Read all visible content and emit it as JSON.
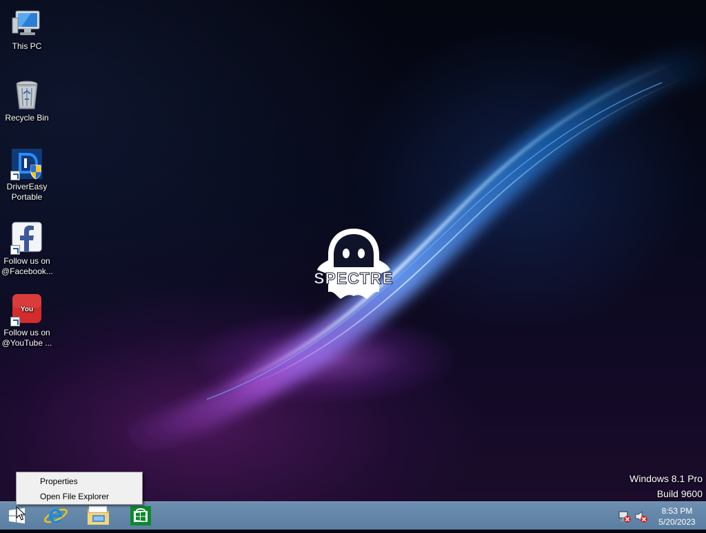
{
  "desktop_icons": [
    {
      "label": "This PC",
      "icon": "computer-icon",
      "shortcut": false
    },
    {
      "label": "Recycle Bin",
      "icon": "recycle-bin-icon",
      "shortcut": false
    },
    {
      "label": "DriverEasy Portable",
      "icon": "drivereasy-icon",
      "shortcut": true
    },
    {
      "label": "Follow us on @Facebook...",
      "icon": "facebook-icon",
      "shortcut": true
    },
    {
      "label": "Follow us on @YouTube ...",
      "icon": "youtube-icon",
      "shortcut": true
    }
  ],
  "wallpaper": {
    "logo_text": "SPECTRE"
  },
  "watermark": {
    "edition": "Windows 8.1 Pro",
    "build": "Build 9600"
  },
  "context_menu": {
    "items": [
      "Properties",
      "Open File Explorer"
    ]
  },
  "taskbar": {
    "pinned": [
      "start-icon",
      "internet-explorer-icon",
      "file-explorer-icon",
      "store-icon"
    ],
    "tray_icons": [
      "network-disconnected-icon",
      "volume-muted-icon"
    ],
    "clock": {
      "time": "8:53 PM",
      "date": "5/20/2023"
    }
  },
  "colors": {
    "taskbar": "#5a7ea2",
    "menu_bg": "#f0f0f0",
    "accent_blue": "#1e9bff",
    "accent_purple": "#b05ce6"
  }
}
